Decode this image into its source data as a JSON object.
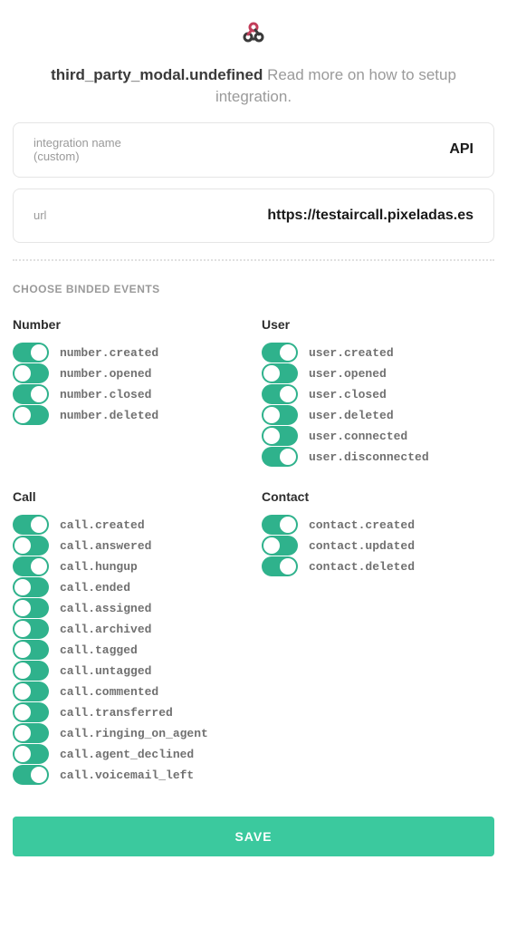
{
  "colors": {
    "accent": "#2fb28c"
  },
  "logo": {
    "alt": "webhooks-icon"
  },
  "header": {
    "title": "third_party_modal.undefined",
    "subtitle": "Read more on how to setup integration."
  },
  "fields": {
    "name_label": "integration name\n(custom)",
    "name_value": "API",
    "url_label": "url",
    "url_value": "https://testaircall.pixeladas.es"
  },
  "section_label": "CHOOSE BINDED EVENTS",
  "groups": [
    {
      "title": "Number",
      "events": [
        {
          "label": "number.created",
          "on": true
        },
        {
          "label": "number.opened",
          "on": false
        },
        {
          "label": "number.closed",
          "on": true
        },
        {
          "label": "number.deleted",
          "on": false
        }
      ]
    },
    {
      "title": "User",
      "events": [
        {
          "label": "user.created",
          "on": true
        },
        {
          "label": "user.opened",
          "on": false
        },
        {
          "label": "user.closed",
          "on": true
        },
        {
          "label": "user.deleted",
          "on": false
        },
        {
          "label": "user.connected",
          "on": false
        },
        {
          "label": "user.disconnected",
          "on": true
        }
      ]
    },
    {
      "title": "Call",
      "events": [
        {
          "label": "call.created",
          "on": true
        },
        {
          "label": "call.answered",
          "on": false
        },
        {
          "label": "call.hungup",
          "on": true
        },
        {
          "label": "call.ended",
          "on": false
        },
        {
          "label": "call.assigned",
          "on": false
        },
        {
          "label": "call.archived",
          "on": false
        },
        {
          "label": "call.tagged",
          "on": false
        },
        {
          "label": "call.untagged",
          "on": false
        },
        {
          "label": "call.commented",
          "on": false
        },
        {
          "label": "call.transferred",
          "on": false
        },
        {
          "label": "call.ringing_on_agent",
          "on": false
        },
        {
          "label": "call.agent_declined",
          "on": false
        },
        {
          "label": "call.voicemail_left",
          "on": true
        }
      ]
    },
    {
      "title": "Contact",
      "events": [
        {
          "label": "contact.created",
          "on": true
        },
        {
          "label": "contact.updated",
          "on": false
        },
        {
          "label": "contact.deleted",
          "on": true
        }
      ]
    }
  ],
  "save_label": "SAVE"
}
